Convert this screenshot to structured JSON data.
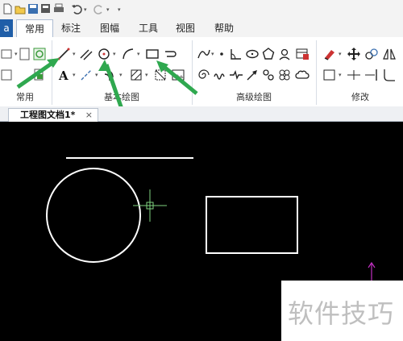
{
  "menubar": {
    "app_label": "a",
    "tabs": [
      {
        "label": "常用",
        "active": true
      },
      {
        "label": "标注",
        "active": false
      },
      {
        "label": "图幅",
        "active": false
      },
      {
        "label": "工具",
        "active": false
      },
      {
        "label": "视图",
        "active": false
      },
      {
        "label": "帮助",
        "active": false
      }
    ]
  },
  "ribbon": {
    "groups": {
      "common": "常用",
      "basic_draw": "基本绘图",
      "advanced_draw": "高级绘图",
      "modify": "修改"
    }
  },
  "document": {
    "tab_title": "工程图文档1*",
    "close_glyph": "×"
  },
  "watermark": "软件技巧",
  "colors": {
    "accent": "#1f5ea8",
    "arrow": "#2fa84f",
    "canvas": "#000000",
    "crosshair": "#7fd27f",
    "ucs": "#c030c0"
  }
}
